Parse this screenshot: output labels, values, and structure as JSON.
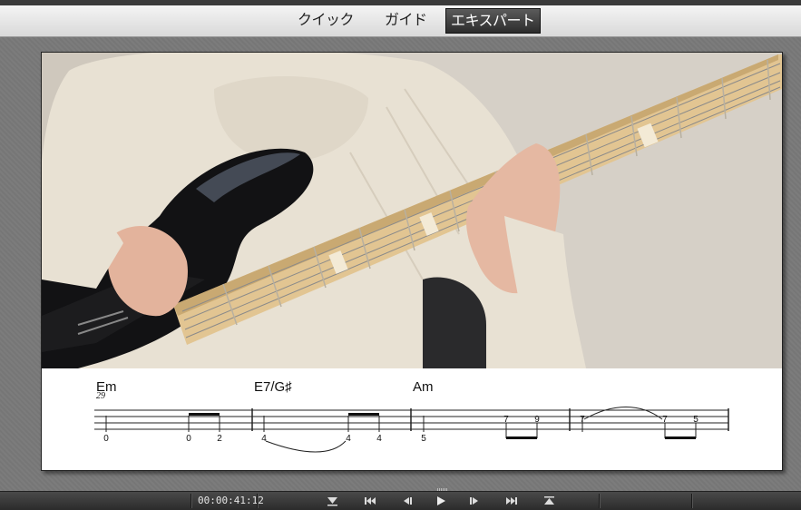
{
  "tabs": [
    {
      "label": "クイック",
      "active": false
    },
    {
      "label": "ガイド",
      "active": false
    },
    {
      "label": "エキスパート",
      "active": true
    }
  ],
  "score": {
    "chords": [
      "Em",
      "E7/G♯",
      "Am"
    ],
    "bar_number": "29",
    "measures": [
      {
        "frets": [
          "0",
          "0",
          "2"
        ]
      },
      {
        "frets": [
          "4",
          "4",
          "4"
        ]
      },
      {
        "frets": [
          "5",
          "7",
          "9"
        ]
      },
      {
        "frets": [
          "7",
          "7",
          "5"
        ]
      }
    ]
  },
  "player": {
    "timecode": "00:00:41:12",
    "controls": [
      "go-to-start",
      "previous-section",
      "step-back",
      "play",
      "step-forward",
      "next-section",
      "go-to-end"
    ]
  },
  "colors": {
    "active_tab_bg": "#3a3a3a",
    "control_bar": "#333333",
    "stage_bg": "#7a7a7a"
  }
}
